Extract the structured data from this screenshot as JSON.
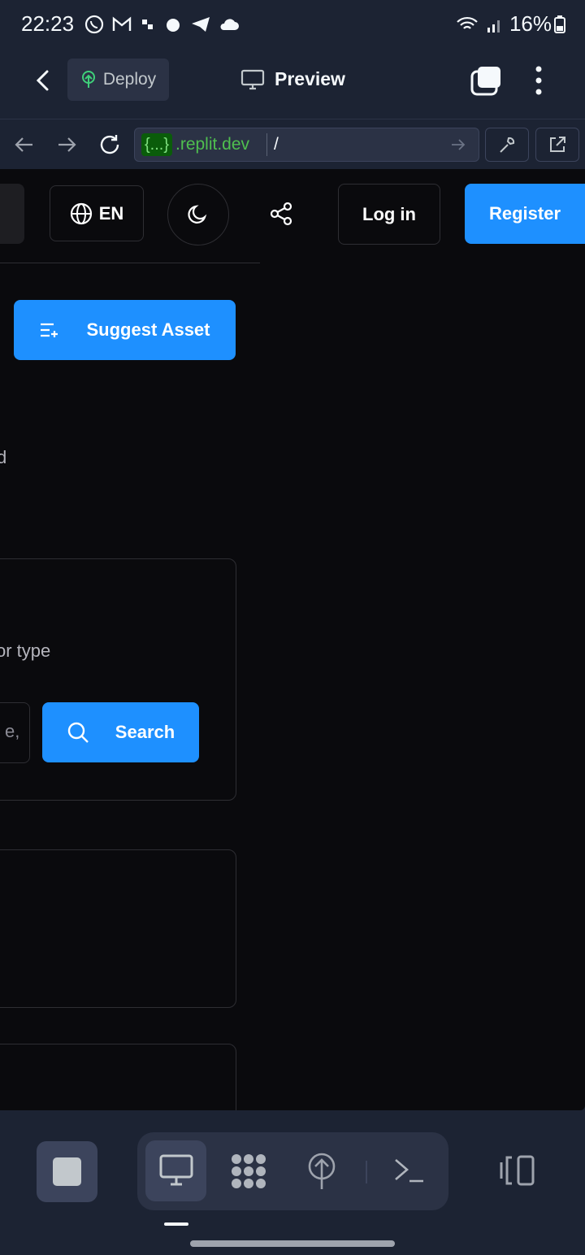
{
  "status_bar": {
    "time": "22:23",
    "battery": "16%"
  },
  "top_bar": {
    "deploy_label": "Deploy",
    "preview_label": "Preview"
  },
  "url_bar": {
    "badge": "{...}",
    "host": ".replit.dev",
    "path": "/"
  },
  "webview": {
    "language": "EN",
    "login_label": "Log in",
    "register_label": "Register",
    "suggest_label": "Suggest Asset",
    "partial_text_1": "d",
    "partial_text_2": "or type",
    "partial_input": "e,",
    "search_label": "Search"
  },
  "colors": {
    "accent": "#1e90ff",
    "chrome_bg": "#1c2333",
    "page_bg": "#0a0a0d"
  }
}
